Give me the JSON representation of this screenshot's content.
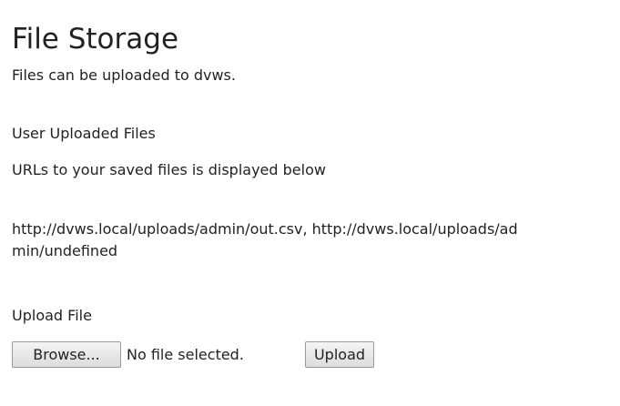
{
  "page": {
    "title": "File Storage",
    "subtitle": "Files can be uploaded to dvws."
  },
  "uploaded": {
    "heading": "User Uploaded Files",
    "note": "URLs to your saved files is displayed below",
    "urls": "http://dvws.local/uploads/admin/out.csv, http://dvws.local/uploads/admin/undefined"
  },
  "upload": {
    "heading": "Upload File",
    "browse_label": "Browse...",
    "file_status": "No file selected.",
    "upload_label": "Upload"
  }
}
